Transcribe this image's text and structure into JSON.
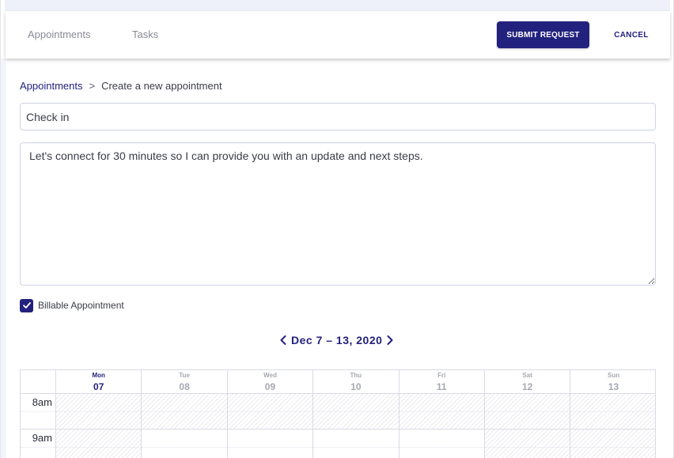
{
  "header": {
    "tabs": [
      {
        "label": "Appointments"
      },
      {
        "label": "Tasks"
      }
    ],
    "submit_label": "SUBMIT REQUEST",
    "cancel_label": "CANCEL"
  },
  "breadcrumb": {
    "parent": "Appointments",
    "separator": ">",
    "current": "Create a new appointment"
  },
  "form": {
    "title_value": "Check in",
    "description_value": "Let's connect for 30 minutes so I can provide you with an update and next steps.",
    "billable_label": "Billable Appointment",
    "billable_checked": true
  },
  "calendar": {
    "week_label": "Dec 7 – 13, 2020",
    "days": [
      {
        "name": "Mon",
        "num": "07",
        "active": true
      },
      {
        "name": "Tue",
        "num": "08",
        "active": false
      },
      {
        "name": "Wed",
        "num": "09",
        "active": false
      },
      {
        "name": "Thu",
        "num": "10",
        "active": false
      },
      {
        "name": "Fri",
        "num": "11",
        "active": false
      },
      {
        "name": "Sat",
        "num": "12",
        "active": false
      },
      {
        "name": "Sun",
        "num": "13",
        "active": false
      }
    ],
    "time_slots": [
      "8am",
      "9am"
    ]
  },
  "colors": {
    "primary": "#23217e",
    "muted_text": "#8a8c96",
    "border": "#cfd2e4"
  },
  "icons": {
    "prev": "chevron-left-icon",
    "next": "chevron-right-icon",
    "check": "check-icon"
  }
}
